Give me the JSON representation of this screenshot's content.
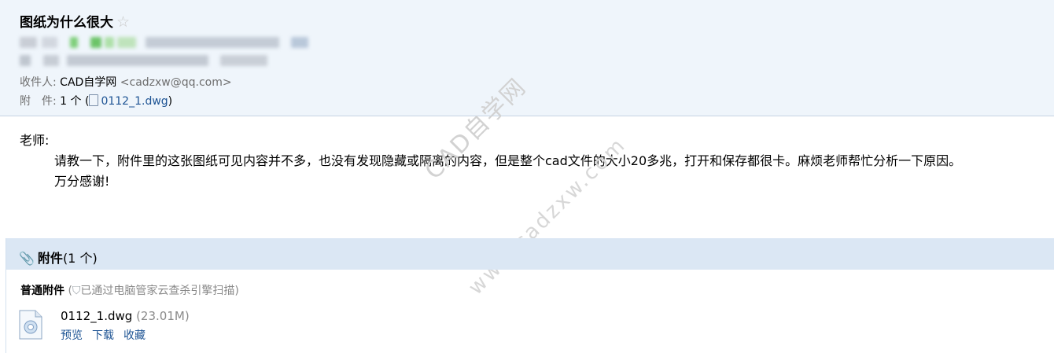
{
  "email": {
    "subject": "图纸为什么很大",
    "star_glyph": "☆",
    "recipient_label": "收件人:",
    "recipient_name": "CAD自学网",
    "recipient_addr": "<cadzxw@qq.com>",
    "attachment_label": "附　件:",
    "attachment_count": "1 个 (",
    "attachment_file": "0112_1.dwg",
    "attachment_close": ")"
  },
  "body": {
    "greeting": "老师:",
    "line1": "请教一下，附件里的这张图纸可见内容并不多，也没有发现隐藏或隔离的内容，但是整个cad文件的大小20多兆，打开和保存都很卡。麻烦老师帮忙分析一下原因。",
    "line2": "万分感谢!"
  },
  "watermark": {
    "line1": "CAD自学网",
    "line2": "www.cadzxw.com"
  },
  "attachments": {
    "title": "附件",
    "count": "(1 个)",
    "section_label": "普通附件",
    "scan_text": "已通过电脑管家云查杀引擎扫描)",
    "scan_open": " (",
    "file_name": "0112_1.dwg",
    "file_size": "(23.01M)",
    "actions": [
      "预览",
      "下载",
      "收藏"
    ]
  },
  "colors": {
    "header_bg": "#eff5fb",
    "attach_bar_bg": "#dbe7f4",
    "link": "#1e5494"
  },
  "icons": [
    "star-icon",
    "file-icon",
    "paperclip-icon",
    "shield-icon",
    "dwg-file-icon"
  ]
}
